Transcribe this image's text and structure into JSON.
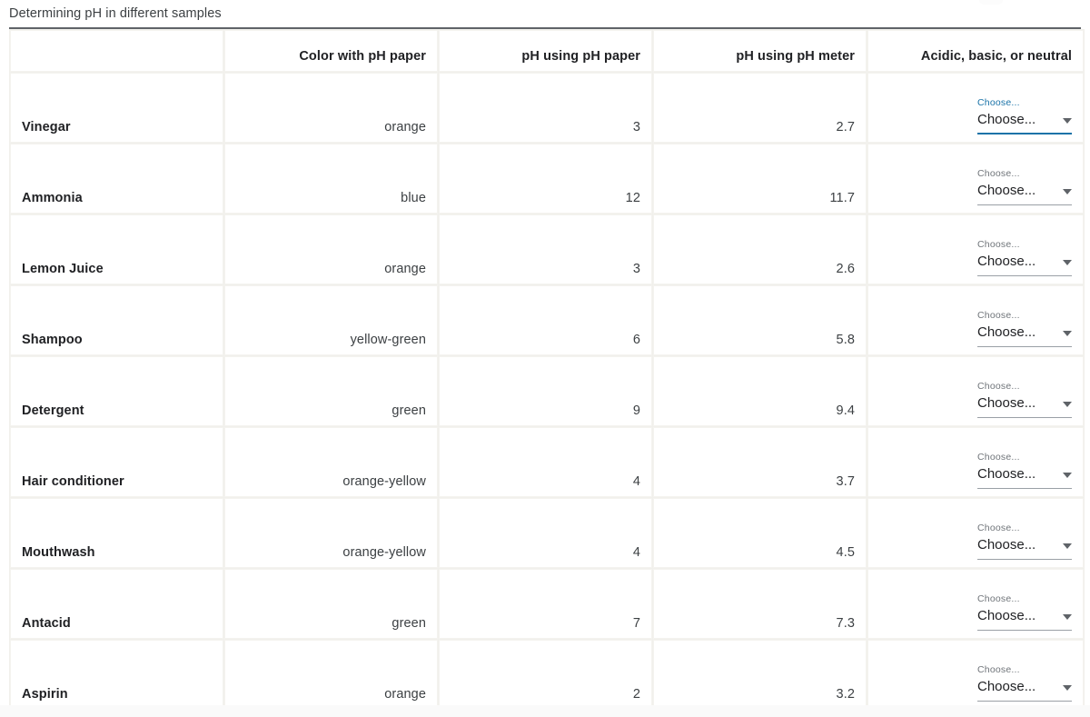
{
  "title": "Determining pH in different samples",
  "table": {
    "headers": [
      "",
      "Color with pH paper",
      "pH using pH paper",
      "pH using pH meter",
      "Acidic, basic, or neutral"
    ],
    "rows": [
      {
        "sample": "Vinegar",
        "color": "orange",
        "ph_paper": "3",
        "ph_meter": "2.7",
        "classification_label": "Choose...",
        "classification_value": "Choose...",
        "focused": true
      },
      {
        "sample": "Ammonia",
        "color": "blue",
        "ph_paper": "12",
        "ph_meter": "11.7",
        "classification_label": "Choose...",
        "classification_value": "Choose...",
        "focused": false
      },
      {
        "sample": "Lemon Juice",
        "color": "orange",
        "ph_paper": "3",
        "ph_meter": "2.6",
        "classification_label": "Choose...",
        "classification_value": "Choose...",
        "focused": false
      },
      {
        "sample": "Shampoo",
        "color": "yellow-green",
        "ph_paper": "6",
        "ph_meter": "5.8",
        "classification_label": "Choose...",
        "classification_value": "Choose...",
        "focused": false
      },
      {
        "sample": "Detergent",
        "color": "green",
        "ph_paper": "9",
        "ph_meter": "9.4",
        "classification_label": "Choose...",
        "classification_value": "Choose...",
        "focused": false
      },
      {
        "sample": "Hair conditioner",
        "color": "orange-yellow",
        "ph_paper": "4",
        "ph_meter": "3.7",
        "classification_label": "Choose...",
        "classification_value": "Choose...",
        "focused": false
      },
      {
        "sample": "Mouthwash",
        "color": "orange-yellow",
        "ph_paper": "4",
        "ph_meter": "4.5",
        "classification_label": "Choose...",
        "classification_value": "Choose...",
        "focused": false
      },
      {
        "sample": "Antacid",
        "color": "green",
        "ph_paper": "7",
        "ph_meter": "7.3",
        "classification_label": "Choose...",
        "classification_value": "Choose...",
        "focused": false
      },
      {
        "sample": "Aspirin",
        "color": "orange",
        "ph_paper": "2",
        "ph_meter": "3.2",
        "classification_label": "Choose...",
        "classification_value": "Choose...",
        "focused": false
      }
    ]
  },
  "colors": {
    "focus_accent": "#1a73a8",
    "text_primary": "#202124",
    "text_secondary": "#3c4043",
    "label_gray": "#70757a",
    "underline_gray": "#9aa0a6",
    "grid_line": "#f1f0ec",
    "title_rule": "#5f6368"
  }
}
